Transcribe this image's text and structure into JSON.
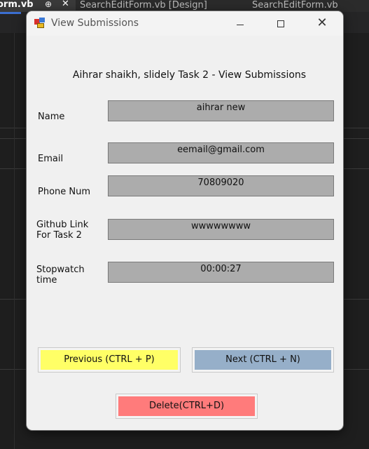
{
  "ide": {
    "tabs": [
      {
        "label": "orm.vb",
        "pin": "⊕",
        "close": "✕"
      },
      {
        "label": "SearchEditForm.vb [Design]"
      },
      {
        "label": "SearchEditForm.vb"
      }
    ]
  },
  "window": {
    "title": "View Submissions",
    "heading": "Aihrar shaikh, slidely Task 2 - View Submissions",
    "controls": {
      "minimize": "—",
      "maximize": "☐",
      "close": "✕"
    }
  },
  "fields": [
    {
      "label": "Name",
      "value": "aihrar new"
    },
    {
      "label": "Email",
      "value": "eemail@gmail.com"
    },
    {
      "label": "Phone Num",
      "value": "70809020"
    },
    {
      "label_line1": "Github Link",
      "label_line2": "For Task 2",
      "value": "wwwwwwww"
    },
    {
      "label_line1": "Stopwatch",
      "label_line2": "time",
      "value": "00:00:27"
    }
  ],
  "buttons": {
    "previous": "Previous (CTRL + P)",
    "next": "Next (CTRL + N)",
    "delete": "Delete(CTRL+D)"
  },
  "colors": {
    "previous": "#ffff66",
    "next": "#96afc9",
    "delete": "#ff7b7b",
    "field_bg": "#acacac"
  }
}
